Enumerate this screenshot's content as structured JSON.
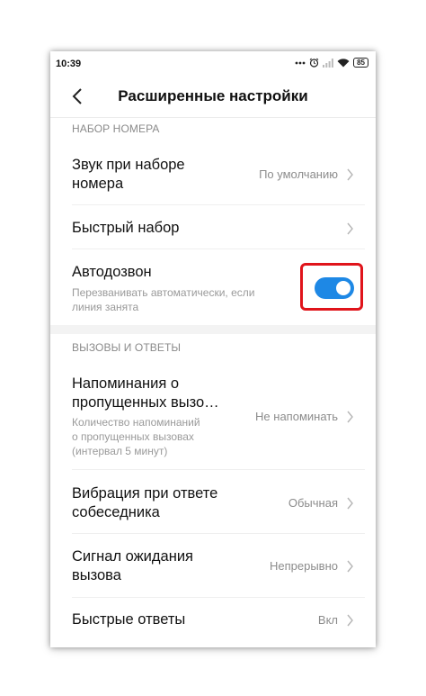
{
  "status_bar": {
    "time": "10:39",
    "battery": "85",
    "icons": [
      "more-dots-icon",
      "alarm-icon",
      "signal-icon",
      "wifi-icon",
      "battery-icon"
    ]
  },
  "header": {
    "title": "Расширенные настройки",
    "back_icon": "back-arrow-icon"
  },
  "sections": [
    {
      "title": "НАБОР НОМЕРА",
      "items": [
        {
          "title_lines": [
            "Звук при наборе",
            "номера"
          ],
          "value": "По умолчанию"
        },
        {
          "title_lines": [
            "Быстрый набор"
          ],
          "value": ""
        },
        {
          "title_lines": [
            "Автодозвон"
          ],
          "subtitle_lines": [
            "Перезванивать автоматически, если",
            "линия занята"
          ],
          "toggle": true
        }
      ]
    },
    {
      "title": "ВЫЗОВЫ И ОТВЕТЫ",
      "items": [
        {
          "title_lines": [
            "Напоминания о",
            "пропущенных вызо…"
          ],
          "subtitle_lines": [
            "Количество напоминаний",
            "о пропущенных вызовах",
            "(интервал 5 минут)"
          ],
          "value": "Не напоминать"
        },
        {
          "title_lines": [
            "Вибрация при ответе",
            "собеседника"
          ],
          "value": "Обычная"
        },
        {
          "title_lines": [
            "Сигнал ожидания",
            "вызова"
          ],
          "value": "Непрерывно"
        },
        {
          "title_lines": [
            "Быстрые ответы"
          ],
          "value": "Вкл"
        }
      ]
    }
  ],
  "colors": {
    "toggle_on": "#1e88e5",
    "highlight": "#e0141b",
    "section_header": "#8a8a8a"
  }
}
